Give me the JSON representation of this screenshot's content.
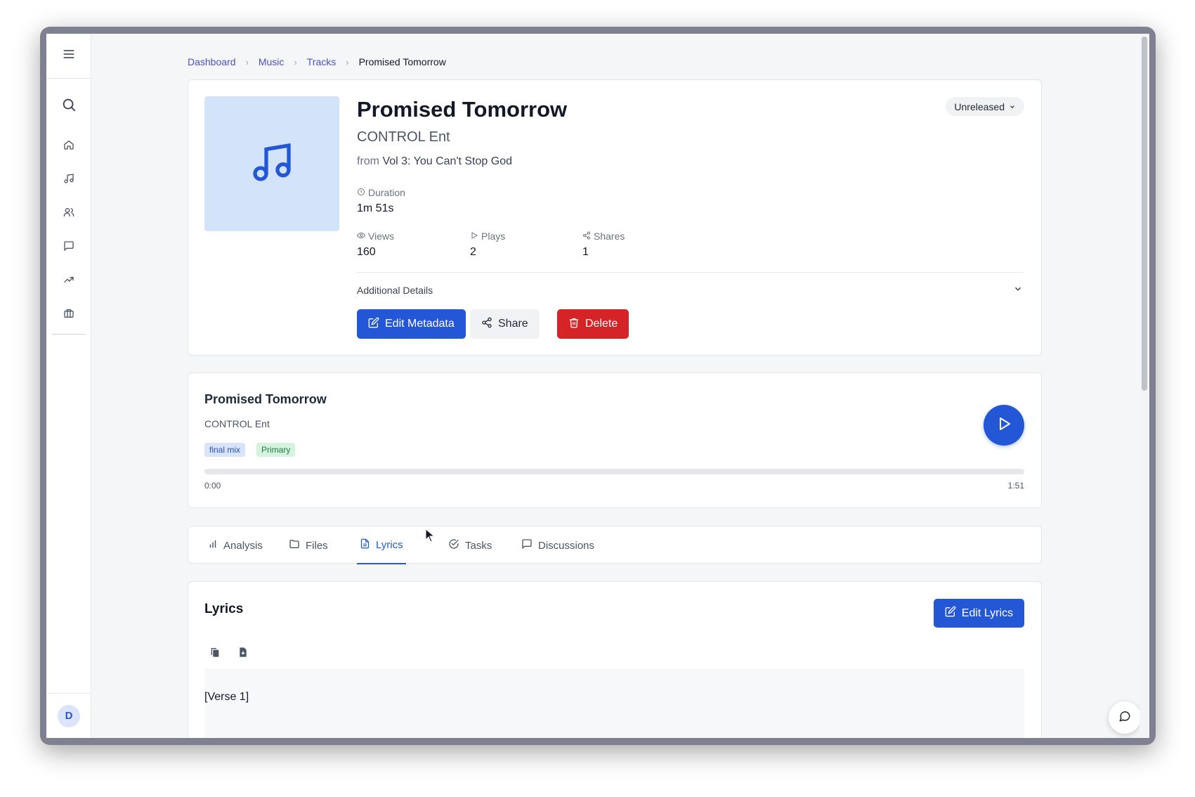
{
  "breadcrumb": {
    "items": [
      "Dashboard",
      "Music",
      "Tracks"
    ],
    "current": "Promised Tomorrow"
  },
  "track": {
    "title": "Promised Tomorrow",
    "artist": "CONTROL Ent",
    "from_prefix": "from",
    "album": "Vol 3: You Can't Stop God",
    "status": "Unreleased",
    "duration_label": "Duration",
    "duration_value": "1m 51s",
    "stats": [
      {
        "label": "Views",
        "value": "160",
        "icon": "eye-icon"
      },
      {
        "label": "Plays",
        "value": "2",
        "icon": "play-icon"
      },
      {
        "label": "Shares",
        "value": "1",
        "icon": "share-icon"
      }
    ],
    "additional_details": "Additional Details",
    "actions": {
      "edit": "Edit Metadata",
      "share": "Share",
      "delete": "Delete"
    }
  },
  "player": {
    "title": "Promised Tomorrow",
    "artist": "CONTROL Ent",
    "tags": [
      "final mix",
      "Primary"
    ],
    "current_time": "0:00",
    "total_time": "1:51",
    "progress": 0
  },
  "tabs": [
    {
      "label": "Analysis",
      "icon": "bar-chart-icon",
      "active": false
    },
    {
      "label": "Files",
      "icon": "folder-icon",
      "active": false
    },
    {
      "label": "Lyrics",
      "icon": "document-icon",
      "active": true
    },
    {
      "label": "Tasks",
      "icon": "check-circle-icon",
      "active": false
    },
    {
      "label": "Discussions",
      "icon": "message-icon",
      "active": false
    }
  ],
  "lyrics": {
    "title": "Lyrics",
    "edit_button": "Edit Lyrics",
    "first_line": "[Verse 1]"
  },
  "user": {
    "avatar_initial": "D"
  },
  "colors": {
    "accent": "#2457d6",
    "danger": "#d42428",
    "art_bg": "#d3e3fa"
  }
}
